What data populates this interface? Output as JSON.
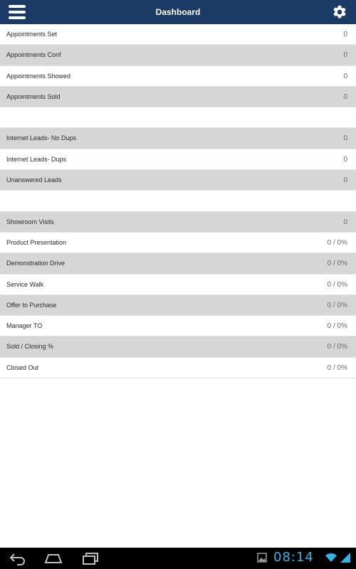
{
  "header": {
    "title": "Dashboard",
    "menu_icon": "hamburger-menu-icon",
    "settings_icon": "gear-icon",
    "bg_color": "#1b3a66"
  },
  "rows": [
    {
      "label": "Appointments Set",
      "value": "0"
    },
    {
      "label": "Appointments Conf",
      "value": "0"
    },
    {
      "label": "Appointments Showed",
      "value": "0"
    },
    {
      "label": "Appointments Sold",
      "value": "0"
    },
    {
      "label": "Internet Leads- No Dups",
      "value": "0"
    },
    {
      "label": "Internet Leads- Dups",
      "value": "0"
    },
    {
      "label": "Unanswered Leads",
      "value": "0"
    },
    {
      "label": "Showroom Visits",
      "value": "0"
    },
    {
      "label": "Product Presentation",
      "value": "0 / 0%"
    },
    {
      "label": "Demonstration Drive",
      "value": "0 / 0%"
    },
    {
      "label": "Service Walk",
      "value": "0 / 0%"
    },
    {
      "label": "Offer to Purchase",
      "value": "0 / 0%"
    },
    {
      "label": "Manager TO",
      "value": "0 / 0%"
    },
    {
      "label": "Sold / Closing %",
      "value": "0 / 0%"
    },
    {
      "label": "Closed Out",
      "value": "0 / 0%"
    }
  ],
  "system_bar": {
    "time": "08:14",
    "back_icon": "back-icon",
    "home_icon": "home-icon",
    "recents_icon": "recent-apps-icon",
    "gallery_icon": "image-notification-icon",
    "wifi_icon": "wifi-icon",
    "signal_icon": "signal-icon",
    "accent_color": "#33b5e5"
  }
}
